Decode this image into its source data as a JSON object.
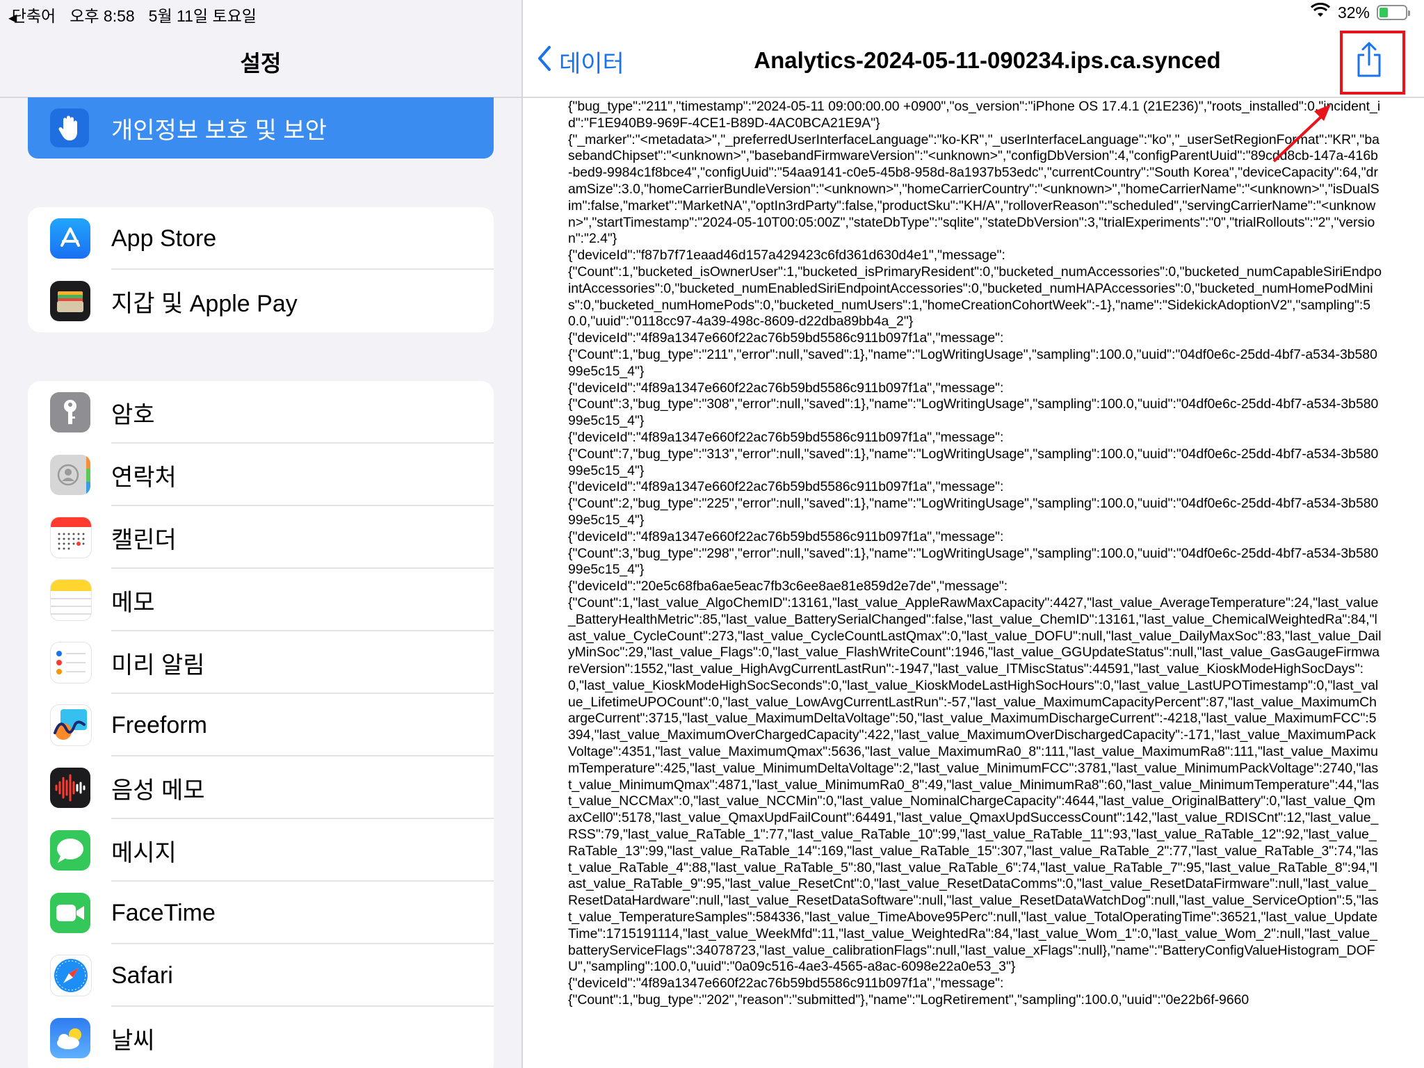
{
  "status_bar": {
    "back_app": "단축어",
    "time": "오후 8:58",
    "date": "5월 11일 토요일",
    "battery_percent_label": "32%",
    "battery_level": 0.32
  },
  "sidebar": {
    "title": "설정",
    "selected_item": {
      "label": "개인정보 보호 및 보안",
      "icon": "hand-icon"
    },
    "groups": [
      {
        "items": [
          {
            "label": "App Store",
            "icon": "app-store-icon",
            "color": "#1a8cf5"
          },
          {
            "label": "지갑 및 Apple Pay",
            "icon": "wallet-icon",
            "color": "#1c1c1e"
          }
        ]
      },
      {
        "items": [
          {
            "label": "암호",
            "icon": "key-icon",
            "color": "#8e8e93"
          },
          {
            "label": "연락처",
            "icon": "contacts-icon",
            "color": "#c8c8c8"
          },
          {
            "label": "캘린더",
            "icon": "calendar-icon",
            "color": "#ffffff"
          },
          {
            "label": "메모",
            "icon": "notes-icon",
            "color": "#ffd52e"
          },
          {
            "label": "미리 알림",
            "icon": "reminders-icon",
            "color": "#ffffff"
          },
          {
            "label": "Freeform",
            "icon": "freeform-icon",
            "color": "#ffffff"
          },
          {
            "label": "음성 메모",
            "icon": "voice-memos-icon",
            "color": "#1c1c1e"
          },
          {
            "label": "메시지",
            "icon": "messages-icon",
            "color": "#34c759"
          },
          {
            "label": "FaceTime",
            "icon": "facetime-icon",
            "color": "#34c759"
          },
          {
            "label": "Safari",
            "icon": "safari-icon",
            "color": "#1a8cf5"
          },
          {
            "label": "날씨",
            "icon": "weather-icon",
            "color": "#2f7cf0"
          }
        ]
      }
    ]
  },
  "detail": {
    "back_label": "데이터",
    "title": "Analytics-2024-05-11-090234.ips.ca.synced",
    "share_icon": "share-icon",
    "accent_color": "#1a73e8",
    "highlight_color": "#e8141b",
    "log_text": "{\"bug_type\":\"211\",\"timestamp\":\"2024-05-11 09:00:00.00 +0900\",\"os_version\":\"iPhone OS 17.4.1 (21E236)\",\"roots_installed\":0,\"incident_id\":\"F1E940B9-969F-4CE1-B89D-4AC0BCA21E9A\"}\n{\"_marker\":\"<metadata>\",\"_preferredUserInterfaceLanguage\":\"ko-KR\",\"_userInterfaceLanguage\":\"ko\",\"_userSetRegionFormat\":\"KR\",\"basebandChipset\":\"<unknown>\",\"basebandFirmwareVersion\":\"<unknown>\",\"configDbVersion\":4,\"configParentUuid\":\"89cdd8cb-147a-416b-bed9-9984c1f8bce4\",\"configUuid\":\"54aa9141-c0e5-45b8-958d-8a1937b53edc\",\"currentCountry\":\"South Korea\",\"deviceCapacity\":64,\"dramSize\":3.0,\"homeCarrierBundleVersion\":\"<unknown>\",\"homeCarrierCountry\":\"<unknown>\",\"homeCarrierName\":\"<unknown>\",\"isDualSim\":false,\"market\":\"MarketNA\",\"optIn3rdParty\":false,\"productSku\":\"KH/A\",\"rolloverReason\":\"scheduled\",\"servingCarrierName\":\"<unknown>\",\"startTimestamp\":\"2024-05-10T00:05:00Z\",\"stateDbType\":\"sqlite\",\"stateDbVersion\":3,\"trialExperiments\":\"0\",\"trialRollouts\":\"2\",\"version\":\"2.4\"}\n{\"deviceId\":\"f87b7f71eaad46d157a429423c6fd361d630d4e1\",\"message\":\n{\"Count\":1,\"bucketed_isOwnerUser\":1,\"bucketed_isPrimaryResident\":0,\"bucketed_numAccessories\":0,\"bucketed_numCapableSiriEndpointAccessories\":0,\"bucketed_numEnabledSiriEndpointAccessories\":0,\"bucketed_numHAPAccessories\":0,\"bucketed_numHomePodMinis\":0,\"bucketed_numHomePods\":0,\"bucketed_numUsers\":1,\"homeCreationCohortWeek\":-1},\"name\":\"SidekickAdoptionV2\",\"sampling\":50.0,\"uuid\":\"0118cc97-4a39-498c-8609-d22dba89bb4a_2\"}\n{\"deviceId\":\"4f89a1347e660f22ac76b59bd5586c911b097f1a\",\"message\":\n{\"Count\":1,\"bug_type\":\"211\",\"error\":null,\"saved\":1},\"name\":\"LogWritingUsage\",\"sampling\":100.0,\"uuid\":\"04df0e6c-25dd-4bf7-a534-3b58099e5c15_4\"}\n{\"deviceId\":\"4f89a1347e660f22ac76b59bd5586c911b097f1a\",\"message\":\n{\"Count\":3,\"bug_type\":\"308\",\"error\":null,\"saved\":1},\"name\":\"LogWritingUsage\",\"sampling\":100.0,\"uuid\":\"04df0e6c-25dd-4bf7-a534-3b58099e5c15_4\"}\n{\"deviceId\":\"4f89a1347e660f22ac76b59bd5586c911b097f1a\",\"message\":\n{\"Count\":7,\"bug_type\":\"313\",\"error\":null,\"saved\":1},\"name\":\"LogWritingUsage\",\"sampling\":100.0,\"uuid\":\"04df0e6c-25dd-4bf7-a534-3b58099e5c15_4\"}\n{\"deviceId\":\"4f89a1347e660f22ac76b59bd5586c911b097f1a\",\"message\":\n{\"Count\":2,\"bug_type\":\"225\",\"error\":null,\"saved\":1},\"name\":\"LogWritingUsage\",\"sampling\":100.0,\"uuid\":\"04df0e6c-25dd-4bf7-a534-3b58099e5c15_4\"}\n{\"deviceId\":\"4f89a1347e660f22ac76b59bd5586c911b097f1a\",\"message\":\n{\"Count\":3,\"bug_type\":\"298\",\"error\":null,\"saved\":1},\"name\":\"LogWritingUsage\",\"sampling\":100.0,\"uuid\":\"04df0e6c-25dd-4bf7-a534-3b58099e5c15_4\"}\n{\"deviceId\":\"20e5c68fba6ae5eac7fb3c6ee8ae81e859d2e7de\",\"message\":\n{\"Count\":1,\"last_value_AlgoChemID\":13161,\"last_value_AppleRawMaxCapacity\":4427,\"last_value_AverageTemperature\":24,\"last_value_BatteryHealthMetric\":85,\"last_value_BatterySerialChanged\":false,\"last_value_ChemID\":13161,\"last_value_ChemicalWeightedRa\":84,\"last_value_CycleCount\":273,\"last_value_CycleCountLastQmax\":0,\"last_value_DOFU\":null,\"last_value_DailyMaxSoc\":83,\"last_value_DailyMinSoc\":29,\"last_value_Flags\":0,\"last_value_FlashWriteCount\":1946,\"last_value_GGUpdateStatus\":null,\"last_value_GasGaugeFirmwareVersion\":1552,\"last_value_HighAvgCurrentLastRun\":-1947,\"last_value_ITMiscStatus\":44591,\"last_value_KioskModeHighSocDays\":0,\"last_value_KioskModeHighSocSeconds\":0,\"last_value_KioskModeLastHighSocHours\":0,\"last_value_LastUPOTimestamp\":0,\"last_value_LifetimeUPOCount\":0,\"last_value_LowAvgCurrentLastRun\":-57,\"last_value_MaximumCapacityPercent\":87,\"last_value_MaximumChargeCurrent\":3715,\"last_value_MaximumDeltaVoltage\":50,\"last_value_MaximumDischargeCurrent\":-4218,\"last_value_MaximumFCC\":5394,\"last_value_MaximumOverChargedCapacity\":422,\"last_value_MaximumOverDischargedCapacity\":-171,\"last_value_MaximumPackVoltage\":4351,\"last_value_MaximumQmax\":5636,\"last_value_MaximumRa0_8\":111,\"last_value_MaximumRa8\":111,\"last_value_MaximumTemperature\":425,\"last_value_MinimumDeltaVoltage\":2,\"last_value_MinimumFCC\":3781,\"last_value_MinimumPackVoltage\":2740,\"last_value_MinimumQmax\":4871,\"last_value_MinimumRa0_8\":49,\"last_value_MinimumRa8\":60,\"last_value_MinimumTemperature\":44,\"last_value_NCCMax\":0,\"last_value_NCCMin\":0,\"last_value_NominalChargeCapacity\":4644,\"last_value_OriginalBattery\":0,\"last_value_QmaxCell0\":5178,\"last_value_QmaxUpdFailCount\":64491,\"last_value_QmaxUpdSuccessCount\":142,\"last_value_RDISCnt\":12,\"last_value_RSS\":79,\"last_value_RaTable_1\":77,\"last_value_RaTable_10\":99,\"last_value_RaTable_11\":93,\"last_value_RaTable_12\":92,\"last_value_RaTable_13\":99,\"last_value_RaTable_14\":169,\"last_value_RaTable_15\":307,\"last_value_RaTable_2\":77,\"last_value_RaTable_3\":74,\"last_value_RaTable_4\":88,\"last_value_RaTable_5\":80,\"last_value_RaTable_6\":74,\"last_value_RaTable_7\":95,\"last_value_RaTable_8\":94,\"last_value_RaTable_9\":95,\"last_value_ResetCnt\":0,\"last_value_ResetDataComms\":0,\"last_value_ResetDataFirmware\":null,\"last_value_ResetDataHardware\":null,\"last_value_ResetDataSoftware\":null,\"last_value_ResetDataWatchDog\":null,\"last_value_ServiceOption\":5,\"last_value_TemperatureSamples\":584336,\"last_value_TimeAbove95Perc\":null,\"last_value_TotalOperatingTime\":36521,\"last_value_UpdateTime\":1715191114,\"last_value_WeekMfd\":11,\"last_value_WeightedRa\":84,\"last_value_Wom_1\":0,\"last_value_Wom_2\":null,\"last_value_batteryServiceFlags\":34078723,\"last_value_calibrationFlags\":null,\"last_value_xFlags\":null},\"name\":\"BatteryConfigValueHistogram_DOFU\",\"sampling\":100.0,\"uuid\":\"0a09c516-4ae3-4565-a8ac-6098e22a0e53_3\"}\n{\"deviceId\":\"4f89a1347e660f22ac76b59bd5586c911b097f1a\",\"message\":\n{\"Count\":1,\"bug_type\":\"202\",\"reason\":\"submitted\"},\"name\":\"LogRetirement\",\"sampling\":100.0,\"uuid\":\"0e22b6f-9660"
  }
}
